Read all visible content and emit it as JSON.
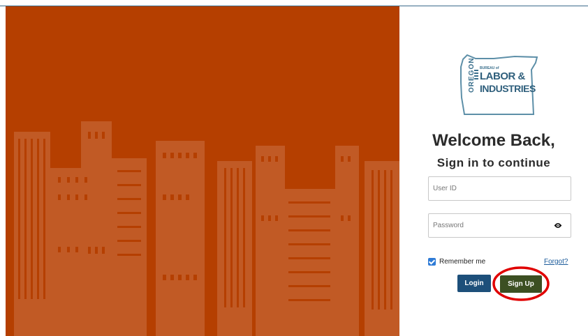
{
  "colors": {
    "left_panel_bg": "#b53f00",
    "skyline_fill": "#c15a25",
    "login_button": "#1d4f7a",
    "signup_button": "#3c4f22",
    "annotation_circle": "#e00000",
    "checkbox_checked": "#2e7bd6"
  },
  "logo": {
    "oregon": "OREGON",
    "bureau_of": "BUREAU of",
    "labor": "LABOR &",
    "industries": "INDUSTRIES"
  },
  "heading": {
    "welcome": "Welcome Back,",
    "subtitle": "Sign in to continue"
  },
  "form": {
    "user_id_placeholder": "User ID",
    "user_id_value": "",
    "password_placeholder": "Password",
    "password_value": "",
    "remember_label": "Remember me",
    "remember_checked": true,
    "forgot_label": "Forgot?",
    "login_label": "Login",
    "signup_label": "Sign Up"
  },
  "icons": {
    "password_toggle": "eye-icon",
    "checkbox": "checkmark-icon"
  }
}
